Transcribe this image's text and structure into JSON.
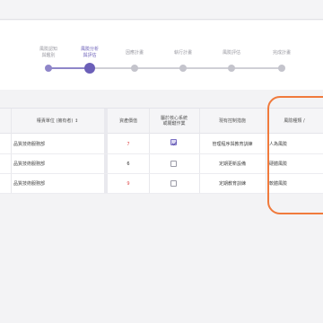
{
  "stepper": {
    "steps": [
      {
        "label": "風險認知\n與鑑別",
        "state": "done"
      },
      {
        "label": "風險分析\n與評估",
        "state": "active"
      },
      {
        "label": "因應計畫",
        "state": "todo"
      },
      {
        "label": "執行計畫",
        "state": "todo"
      },
      {
        "label": "風險評估",
        "state": "todo"
      },
      {
        "label": "完成計畫",
        "state": "todo"
      }
    ]
  },
  "table": {
    "headers": {
      "owner": "權責單位 (擁有者) ↕",
      "value": "資產價值",
      "critical": "屬於核心系統\n或關鍵作業",
      "control": "現有控制措施",
      "risk_type": "風險種類 /"
    },
    "rows": [
      {
        "owner": "品質技術服務部",
        "value": "7",
        "value_color": "red",
        "checked": true,
        "control": "管理程序與教育訓練",
        "risk_type": "人為風險"
      },
      {
        "owner": "品質技術服務部",
        "value": "6",
        "value_color": "black",
        "checked": false,
        "control": "定期更新設備",
        "risk_type": "硬體風險"
      },
      {
        "owner": "品質技術服務部",
        "value": "9",
        "value_color": "red",
        "checked": false,
        "control": "定期教育訓練",
        "risk_type": "軟體風險"
      }
    ]
  },
  "colors": {
    "accent": "#6b5fb8",
    "highlight": "#f07a3c",
    "value_red": "#e05050"
  }
}
